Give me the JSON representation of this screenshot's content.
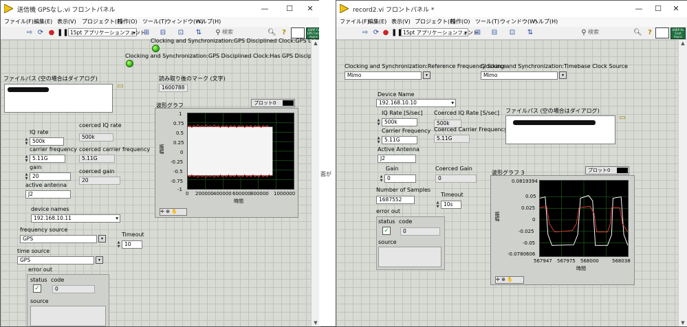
{
  "window1": {
    "title": "送信機 GPSなし.vi フロントパネル",
    "controls": {
      "minimize": "—",
      "maximize": "☐",
      "close": "✕"
    },
    "menu": [
      "ファイル(F)",
      "編集(E)",
      "表示(V)",
      "プロジェクト(P)",
      "操作(O)",
      "ツール(T)",
      "ウィンドウ(W)",
      "ヘルプ(H)"
    ],
    "font_selector": "15pt アプリケーションフォント",
    "search_placeholder": "検索",
    "usrp_icon_text": "USRP\nTx\nGPS\nCont\nAsync",
    "gps_lock_label": "Clocking and Synchronization:GPS Disciplined Clock:GPS Lock Status",
    "gps_has_label": "Clocking and Synchronization:GPS Disciplined Clock:Has GPS Disciplined Clock?",
    "file_path_label": "ファイルパス (空の場合はダイアログ)",
    "marker_label": "読み取り後のマーク (文字)",
    "marker_value": "1600788",
    "graph_label": "波形グラフ",
    "plot_legend": "プロット0",
    "iq_rate_label": "IQ rate",
    "iq_rate_value": "500k",
    "coerced_iq_label": "coerced IQ rate",
    "coerced_iq_value": "500k",
    "carrier_label": "carrier frequency",
    "carrier_value": "5.11G",
    "coerced_carrier_label": "coerced carrier frequency",
    "coerced_carrier_value": "5.11G",
    "gain_label": "gain",
    "gain_value": "20",
    "coerced_gain_label": "coerced gain",
    "coerced_gain_value": "20",
    "antenna_label": "active antenna",
    "antenna_value": "J2",
    "device_label": "device names",
    "device_value": "192.168.10.11",
    "freq_source_label": "frequency source",
    "freq_source_value": "GPS",
    "timeout_label": "Timeout",
    "timeout_value": "10",
    "time_source_label": "time source",
    "time_source_value": "GPS",
    "error_out_label": "error out",
    "status_label": "status",
    "code_label": "code",
    "code_value": "0",
    "source_label": "source",
    "y_axis_label": "振幅",
    "x_axis_label": "時間",
    "y_ticks": [
      "1",
      "0.75",
      "0.5",
      "0.25",
      "0",
      "-0.25",
      "-0.5",
      "-0.75",
      "-1"
    ],
    "x_ticks": [
      "0",
      "200000",
      "400000",
      "600000",
      "800000",
      "1000000"
    ]
  },
  "window2": {
    "title": "record2.vi フロントパネル *",
    "controls": {
      "minimize": "—",
      "maximize": "☐",
      "close": "✕"
    },
    "menu": [
      "ファイル(F)",
      "編集(E)",
      "表示(V)",
      "プロジェクト(P)",
      "操作(O)",
      "ツール(T)",
      "ウィンドウ(W)",
      "ヘルプ(H)"
    ],
    "font_selector": "15pt アプリケーションフォント",
    "search_placeholder": "検索",
    "usrp_icon_text": "USRP\nRx\nCont\nAsync",
    "ref_freq_label": "Clocking and Synchronization:Reference Frequency Source",
    "ref_freq_value": "Mimo",
    "timebase_label": "Clocking and Synchronization:Timebase Clock Source",
    "timebase_value": "Mimo",
    "device_label": "Device Name",
    "device_value": "192.168.10.10",
    "iq_rate_label": "IQ Rate [S/sec]",
    "iq_rate_value": "500k",
    "coerced_iq_label": "Coerced IQ Rate [S/sec]",
    "coerced_iq_value": "500k",
    "carrier_label": "Carrier Frequency",
    "carrier_value": "5.11G",
    "coerced_carrier_label": "Coerced Carrier Frequency",
    "coerced_carrier_value": "5.11G",
    "file_path_label": "ファイルパス (空の場合はダイアログ)",
    "antenna_label": "Active Antenna",
    "antenna_value": "J2",
    "gain_label": "Gain",
    "gain_value": "0",
    "coerced_gain_label": "Coerced Gain",
    "coerced_gain_value": "0",
    "graph_label": "波形グラフ 3",
    "plot_legend": "プロット0",
    "samples_label": "Number of Samples",
    "samples_value": "1687552",
    "timeout_label": "Timeout",
    "timeout_value": "10s",
    "error_out_label": "error out",
    "status_label": "status",
    "code_label": "code",
    "code_value": "0",
    "source_label": "source",
    "y_axis_label": "振幅",
    "x_axis_label": "時間",
    "y_ticks": [
      "0.0819394",
      "0.05",
      "0.025",
      "0",
      "-0.025",
      "-0.05",
      "-0.0780606"
    ],
    "x_ticks": [
      "567947",
      "567975",
      "568000",
      "568038"
    ]
  },
  "background_text": "面が"
}
